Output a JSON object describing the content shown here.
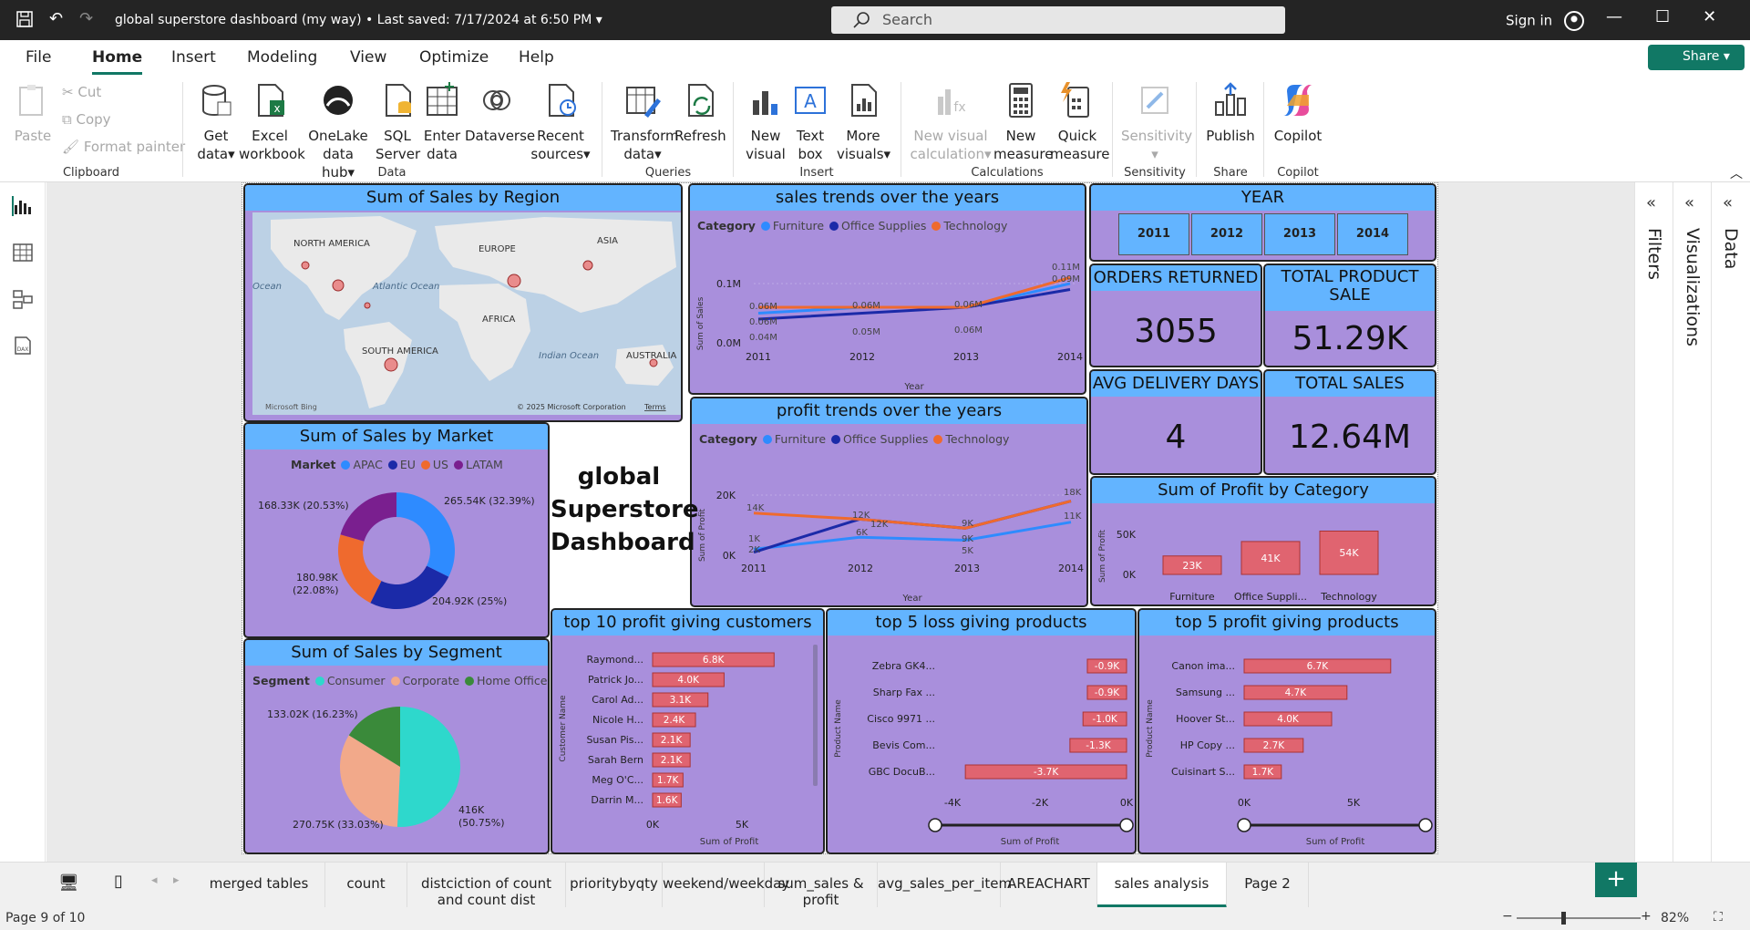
{
  "window": {
    "title": "global superstore dashboard (my way) • Last saved: 7/17/2024 at 6:50 PM",
    "search_placeholder": "Search",
    "sign_in": "Sign in"
  },
  "menu": {
    "file": "File",
    "home": "Home",
    "insert": "Insert",
    "modeling": "Modeling",
    "view": "View",
    "optimize": "Optimize",
    "help": "Help",
    "share": "Share"
  },
  "ribbon": {
    "paste": "Paste",
    "cut": "Cut",
    "copy": "Copy",
    "format_painter": "Format painter",
    "clipboard": "Clipboard",
    "get_data": [
      "Get",
      "data"
    ],
    "excel": [
      "Excel",
      "workbook"
    ],
    "onelake": [
      "OneLake",
      "data hub"
    ],
    "sql": [
      "SQL",
      "Server"
    ],
    "enter_data": [
      "Enter",
      "data"
    ],
    "dataverse": "Dataverse",
    "recent": [
      "Recent",
      "sources"
    ],
    "data": "Data",
    "transform": [
      "Transform",
      "data"
    ],
    "refresh": "Refresh",
    "queries": "Queries",
    "new_visual": [
      "New",
      "visual"
    ],
    "text_box": [
      "Text",
      "box"
    ],
    "more_visuals": [
      "More",
      "visuals"
    ],
    "insert": "Insert",
    "new_calc": [
      "New visual",
      "calculation"
    ],
    "new_measure": [
      "New",
      "measure"
    ],
    "quick_measure": [
      "Quick",
      "measure"
    ],
    "calculations": "Calculations",
    "sensitivity_btn": "Sensitivity",
    "sensitivity": "Sensitivity",
    "publish": "Publish",
    "share": "Share",
    "copilot_btn": "Copilot",
    "copilot": "Copilot"
  },
  "dashboard": {
    "title": [
      "global",
      "Superstore",
      "Dashboard"
    ],
    "map": {
      "title": "Sum of Sales by Region",
      "labels": [
        "NORTH AMERICA",
        "EUROPE",
        "ASIA",
        "Atlantic Ocean",
        "AFRICA",
        "SOUTH AMERICA",
        "Indian Ocean",
        "AUSTRALIA",
        "Ocean"
      ],
      "bing": "Microsoft Bing",
      "copyright": "© 2025 Microsoft Corporation",
      "terms": "Terms"
    },
    "sales_trend": {
      "title": "sales trends over the years",
      "legend_title": "Category",
      "ylabel": "Sum of Sales",
      "xlabel": "Year",
      "yticks": [
        "0.1M",
        "0.0M"
      ],
      "chart_data": {
        "type": "line",
        "x": [
          "2011",
          "2012",
          "2013",
          "2014"
        ],
        "series": [
          {
            "name": "Furniture",
            "color": "#2e8bff",
            "values": [
              0.05,
              0.06,
              0.06,
              0.1
            ]
          },
          {
            "name": "Office Supplies",
            "color": "#1b2aa8",
            "values": [
              0.04,
              0.05,
              0.06,
              0.09
            ]
          },
          {
            "name": "Technology",
            "color": "#ef6a2e",
            "values": [
              0.06,
              0.06,
              0.06,
              0.11
            ]
          }
        ],
        "labels": [
          "0.06M",
          "0.06M",
          "0.04M",
          "0.06M",
          "0.05M",
          "0.06M",
          "0.06M",
          "0.11M",
          "0.09M"
        ]
      }
    },
    "profit_trend": {
      "title": "profit trends over the years",
      "legend_title": "Category",
      "ylabel": "Sum of Profit",
      "xlabel": "Year",
      "yticks": [
        "20K",
        "0K"
      ],
      "chart_data": {
        "type": "line",
        "x": [
          "2011",
          "2012",
          "2013",
          "2014"
        ],
        "series": [
          {
            "name": "Furniture",
            "color": "#2e8bff",
            "values": [
              2,
              6,
              5,
              11
            ]
          },
          {
            "name": "Office Supplies",
            "color": "#1b2aa8",
            "values": [
              1,
              12,
              9,
              18
            ]
          },
          {
            "name": "Technology",
            "color": "#ef6a2e",
            "values": [
              14,
              12,
              9,
              18
            ]
          }
        ],
        "labels": [
          "14K",
          "1K",
          "2K",
          "12K",
          "12K",
          "6K",
          "9K",
          "9K",
          "5K",
          "18K",
          "11K"
        ]
      }
    },
    "year_slicer": {
      "title": "YEAR",
      "years": [
        "2011",
        "2012",
        "2013",
        "2014"
      ]
    },
    "kpi": {
      "orders_returned_title": "ORDERS RETURNED",
      "orders_returned": "3055",
      "total_product_sale_title": "TOTAL PRODUCT SALE",
      "total_product_sale": "51.29K",
      "avg_delivery_title": "AVG DELIVERY DAYS",
      "avg_delivery": "4",
      "total_sales_title": "TOTAL SALES",
      "total_sales": "12.64M"
    },
    "profit_category": {
      "title": "Sum of Profit by Category",
      "ylabel": "Sum of Profit",
      "yticks": [
        "50K",
        "0K"
      ],
      "chart_data": {
        "type": "bar",
        "categories": [
          "Furniture",
          "Office Suppli...",
          "Technology"
        ],
        "values": [
          23,
          41,
          54
        ],
        "labels": [
          "23K",
          "41K",
          "54K"
        ]
      }
    },
    "market": {
      "title": "Sum of Sales by Market",
      "legend_title": "Market",
      "chart_data": {
        "type": "pie",
        "slices": [
          {
            "name": "APAC",
            "value": 265.54,
            "label": "265.54K (32.39%)",
            "color": "#2e8bff"
          },
          {
            "name": "EU",
            "value": 204.92,
            "label": "204.92K (25%)",
            "color": "#1b2aa8"
          },
          {
            "name": "US",
            "value": 180.98,
            "label": "180.98K",
            "label2": "(22.08%)",
            "color": "#ef6a2e"
          },
          {
            "name": "LATAM",
            "value": 168.33,
            "label": "168.33K (20.53%)",
            "color": "#7a1f8f"
          }
        ]
      }
    },
    "segment": {
      "title": "Sum of Sales by Segment",
      "legend_title": "Segment",
      "chart_data": {
        "type": "pie",
        "slices": [
          {
            "name": "Consumer",
            "value": 416,
            "label": "416K",
            "label2": "(50.75%)",
            "color": "#2ed8cc"
          },
          {
            "name": "Corporate",
            "value": 270.75,
            "label": "270.75K (33.03%)",
            "color": "#f2a98a"
          },
          {
            "name": "Home Office",
            "value": 133.02,
            "label": "133.02K (16.23%)",
            "color": "#3a8a3a"
          }
        ]
      }
    },
    "customers": {
      "title": "top 10 profit giving customers",
      "ylabel": "Customer Name",
      "xlabel": "Sum of Profit",
      "xticks": [
        "0K",
        "5K"
      ],
      "chart_data": {
        "type": "bar",
        "categories": [
          "Raymond...",
          "Patrick Jo...",
          "Carol Ad...",
          "Nicole H...",
          "Susan Pis...",
          "Sarah Bern",
          "Meg O'C...",
          "Darrin M..."
        ],
        "values": [
          6.8,
          4.0,
          3.1,
          2.4,
          2.1,
          2.1,
          1.7,
          1.6
        ],
        "labels": [
          "6.8K",
          "4.0K",
          "3.1K",
          "2.4K",
          "2.1K",
          "2.1K",
          "1.7K",
          "1.6K"
        ]
      }
    },
    "loss_products": {
      "title": "top 5 loss giving products",
      "ylabel": "Product Name",
      "xlabel": "Sum of Profit",
      "xticks": [
        "-4K",
        "-2K",
        "0K"
      ],
      "chart_data": {
        "type": "bar",
        "categories": [
          "Zebra GK4...",
          "Sharp Fax ...",
          "Cisco 9971 ...",
          "Bevis Com...",
          "GBC DocuB..."
        ],
        "values": [
          -0.9,
          -0.9,
          -1.0,
          -1.3,
          -3.7
        ],
        "labels": [
          "-0.9K",
          "-0.9K",
          "-1.0K",
          "-1.3K",
          "-3.7K"
        ]
      }
    },
    "profit_products": {
      "title": "top 5 profit giving products",
      "ylabel": "Product Name",
      "xlabel": "Sum of Profit",
      "xticks": [
        "0K",
        "5K"
      ],
      "chart_data": {
        "type": "bar",
        "categories": [
          "Canon ima...",
          "Samsung ...",
          "Hoover St...",
          "HP Copy ...",
          "Cuisinart S..."
        ],
        "values": [
          6.7,
          4.7,
          4.0,
          2.7,
          1.7
        ],
        "labels": [
          "6.7K",
          "4.7K",
          "4.0K",
          "2.7K",
          "1.7K"
        ]
      }
    }
  },
  "panes": {
    "filters": "Filters",
    "visualizations": "Visualizations",
    "data": "Data"
  },
  "tabs": [
    "merged tables",
    "count",
    "distciction of count and count dist",
    "prioritybyqty",
    "weekend/weekday",
    "sum_sales & profit",
    "avg_sales_per_item",
    "AREACHART",
    "sales analysis",
    "Page 2"
  ],
  "status": {
    "page": "Page 9 of 10",
    "zoom": "82%"
  }
}
